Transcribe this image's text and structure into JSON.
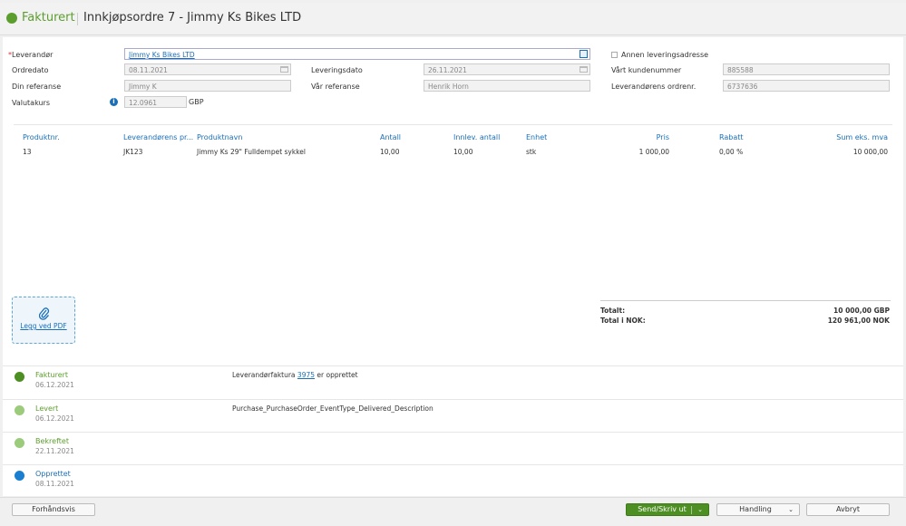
{
  "header": {
    "status": "Fakturert",
    "title": "Innkjøpsordre 7 - Jimmy Ks Bikes LTD",
    "status_color": "#5c9e2e"
  },
  "form": {
    "supplier_req": "*",
    "supplier_label": "Leverandør",
    "supplier_value": "Jimmy Ks Bikes LTD",
    "order_date_label": "Ordredato",
    "order_date_value": "08.11.2021",
    "delivery_date_label": "Leveringsdato",
    "delivery_date_value": "26.11.2021",
    "your_ref_label": "Din referanse",
    "your_ref_value": "Jimmy K",
    "our_ref_label": "Vår referanse",
    "our_ref_value": "Henrik Horn",
    "currency_rate_label": "Valutakurs",
    "currency_rate_value": "12.0961",
    "currency_code": "GBP",
    "other_address_label": "Annen leveringsadresse",
    "customer_no_label": "Vårt kundenummer",
    "customer_no_value": "885588",
    "supplier_order_no_label": "Leverandørens ordrenr.",
    "supplier_order_no_value": "6737636"
  },
  "table": {
    "headers": [
      "Produktnr.",
      "Leverandørens pr...",
      "Produktnavn",
      "Antall",
      "Innlev. antall",
      "Enhet",
      "Pris",
      "Rabatt",
      "Sum eks. mva"
    ],
    "rows": [
      [
        "13",
        "JK123",
        "Jimmy Ks 29\" Fulldempet sykkel",
        "10,00",
        "10,00",
        "stk",
        "1 000,00",
        "0,00 %",
        "10 000,00"
      ]
    ]
  },
  "attach": {
    "label": "Legg ved PDF"
  },
  "totals": {
    "total_label": "Totalt:",
    "total_value": "10 000,00 GBP",
    "total_nok_label": "Total i NOK:",
    "total_nok_value": "120 961,00 NOK"
  },
  "timeline": [
    {
      "name": "Fakturert",
      "date": "06.12.2021",
      "desc_pre": "Leverandørfaktura ",
      "desc_link": "3975",
      "desc_post": " er opprettet",
      "color": "#4e8f23"
    },
    {
      "name": "Levert",
      "date": "06.12.2021",
      "desc_pre": "Purchase_PurchaseOrder_EventType_Delivered_Description",
      "desc_link": "",
      "desc_post": "",
      "color": "#9ccb7b"
    },
    {
      "name": "Bekreftet",
      "date": "22.11.2021",
      "desc_pre": "",
      "desc_link": "",
      "desc_post": "",
      "color": "#9ccb7b"
    },
    {
      "name": "Opprettet",
      "date": "08.11.2021",
      "desc_pre": "",
      "desc_link": "",
      "desc_post": "",
      "color": "#1a7fd0"
    }
  ],
  "footer": {
    "preview": "Forhåndsvis",
    "send": "Send/Skriv ut",
    "action": "Handling",
    "cancel": "Avbryt",
    "chevron": "⌄"
  }
}
